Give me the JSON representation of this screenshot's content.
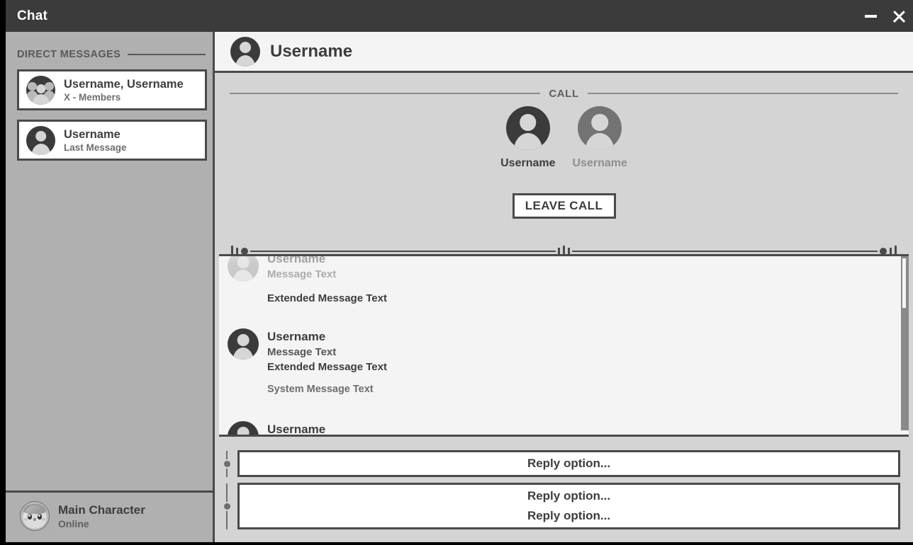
{
  "window": {
    "title": "Chat",
    "minimize_icon": "minimize-icon",
    "close_icon": "close-icon",
    "titlebar_color": "#3b3b3b"
  },
  "sidebar": {
    "section_header": "DIRECT MESSAGES",
    "conversations": [
      {
        "name": "Username, Username",
        "subtitle": "X - Members",
        "avatar": "group-avatar",
        "selected": true
      },
      {
        "name": "Username",
        "subtitle": "Last Message",
        "avatar": "person-avatar",
        "selected": false
      }
    ],
    "profile": {
      "name": "Main Character",
      "status": "Online",
      "avatar": "creature-avatar"
    }
  },
  "chat": {
    "header": {
      "title": "Username",
      "avatar": "person-avatar"
    },
    "call": {
      "label": "CALL",
      "participants": [
        {
          "name": "Username",
          "state": "active"
        },
        {
          "name": "Username",
          "state": "inactive"
        }
      ],
      "leave_button": "LEAVE CALL"
    },
    "resize_handle": {
      "left_grip": "slider-grip-left",
      "center_grip": "slider-grip-center",
      "right_grip": "slider-grip-right"
    },
    "messages": [
      {
        "id": "m1",
        "avatar": "person-avatar-faded",
        "name": "Username",
        "lines": [
          {
            "text": "Message Text",
            "style": "message"
          }
        ],
        "faded": true
      },
      {
        "id": "m2",
        "avatar": null,
        "name": null,
        "lines": [
          {
            "text": "Extended Message Text",
            "style": "extended"
          }
        ],
        "faded": false
      },
      {
        "id": "m3",
        "avatar": "person-avatar",
        "name": "Username",
        "lines": [
          {
            "text": "Message Text",
            "style": "message"
          },
          {
            "text": "Extended Message Text",
            "style": "extended"
          }
        ],
        "faded": false
      },
      {
        "id": "m4",
        "avatar": null,
        "name": null,
        "lines": [
          {
            "text": "System Message Text",
            "style": "system"
          }
        ],
        "faded": false
      },
      {
        "id": "m5",
        "avatar": "person-avatar",
        "name": "Username",
        "lines": [],
        "typing": true,
        "faded": false
      }
    ],
    "scrollbar": {
      "present": true
    }
  },
  "replies": [
    {
      "id": "r1",
      "options": [
        "Reply option..."
      ]
    },
    {
      "id": "r2",
      "options": [
        "Reply option...",
        "Reply option..."
      ]
    }
  ],
  "colors": {
    "window_chrome": "#3b3b3b",
    "sidebar_bg": "#b0b0b0",
    "panel_bg": "#d4d4d4",
    "surface": "#f4f4f4",
    "outline": "#4a4a4a",
    "text_primary": "#3d3d3d",
    "text_secondary": "#6e6e6e",
    "text_muted": "#8f8f8f"
  }
}
